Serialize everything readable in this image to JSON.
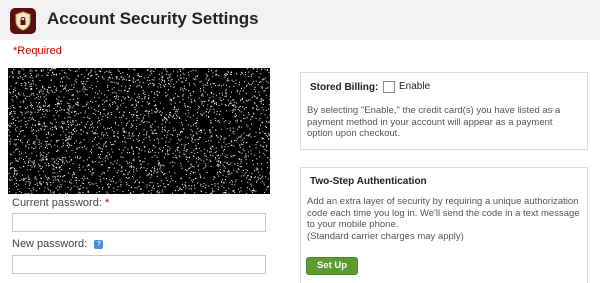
{
  "header": {
    "title": "Account Security Settings"
  },
  "form": {
    "required_note": "*Required",
    "current_password": {
      "label": "Current password:",
      "required_mark": "*",
      "value": ""
    },
    "new_password": {
      "label": "New password:",
      "help_glyph": "?",
      "value": ""
    }
  },
  "stored_billing": {
    "title": "Stored Billing:",
    "checkbox_label": "Enable",
    "checked": false,
    "description": "By selecting \"Enable,\" the credit card(s) you have listed as a payment method in your account will appear as a payment option upon checkout."
  },
  "two_step": {
    "title": "Two-Step Authentication",
    "description": "Add an extra layer of security by requiring a unique authorization code each time you log in. We'll send the code in a text message to your mobile phone.",
    "note": "(Standard carrier charges may apply)",
    "button_label": "Set Up"
  },
  "colors": {
    "required": "#cc0000",
    "setup_button": "#5c9c2e",
    "logo_bg": "#5a1010"
  }
}
